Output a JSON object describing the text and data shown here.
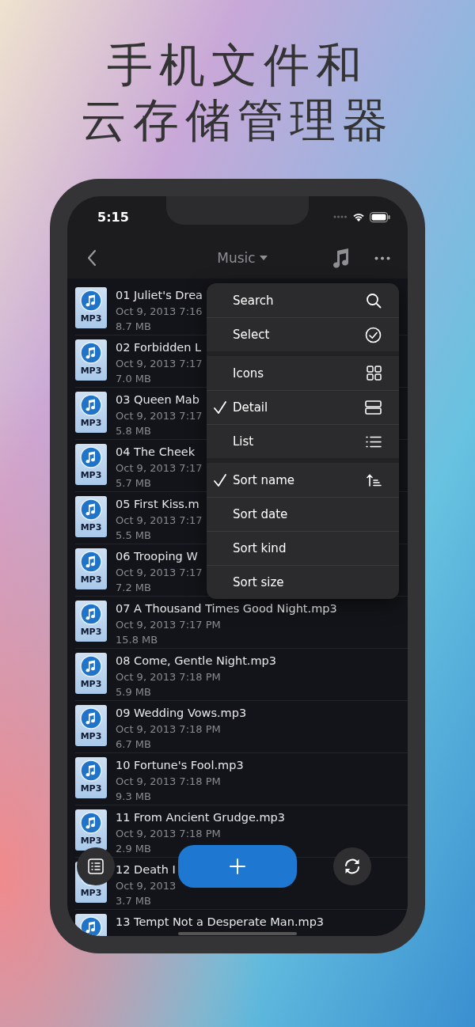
{
  "headline": [
    "手机文件和",
    "云存储管理器"
  ],
  "status_bar": {
    "time": "5:15"
  },
  "nav": {
    "title": "Music"
  },
  "files": [
    {
      "name": "01 Juliet's Drea",
      "date": "Oct 9, 2013 7:16",
      "size": "8.7 MB",
      "badge": "MP3"
    },
    {
      "name": "02 Forbidden L",
      "date": "Oct 9, 2013 7:17",
      "size": "7.0 MB",
      "badge": "MP3"
    },
    {
      "name": "03 Queen Mab",
      "date": "Oct 9, 2013 7:17",
      "size": "5.8 MB",
      "badge": "MP3"
    },
    {
      "name": "04 The Cheek",
      "date": "Oct 9, 2013 7:17",
      "size": "5.7 MB",
      "badge": "MP3"
    },
    {
      "name": "05 First Kiss.m",
      "date": "Oct 9, 2013 7:17",
      "size": "5.5 MB",
      "badge": "MP3"
    },
    {
      "name": "06 Trooping W",
      "date": "Oct 9, 2013 7:17",
      "size": "7.2 MB",
      "badge": "MP3"
    },
    {
      "name": "07 A Thousand Times Good Night.mp3",
      "date": "Oct 9, 2013 7:17 PM",
      "size": "15.8 MB",
      "badge": "MP3"
    },
    {
      "name": "08 Come, Gentle Night.mp3",
      "date": "Oct 9, 2013 7:18 PM",
      "size": "5.9 MB",
      "badge": "MP3"
    },
    {
      "name": "09 Wedding Vows.mp3",
      "date": "Oct 9, 2013 7:18 PM",
      "size": "6.7 MB",
      "badge": "MP3"
    },
    {
      "name": "10 Fortune's Fool.mp3",
      "date": "Oct 9, 2013 7:18 PM",
      "size": "9.3 MB",
      "badge": "MP3"
    },
    {
      "name": "11 From Ancient Grudge.mp3",
      "date": "Oct 9, 2013 7:18 PM",
      "size": "2.9 MB",
      "badge": "MP3"
    },
    {
      "name": "12 Death I",
      "date": "Oct 9, 2013",
      "size": "3.7 MB",
      "badge": "MP3"
    },
    {
      "name": "13 Tempt Not a Desperate Man.mp3"
    }
  ],
  "menu": [
    [
      {
        "label": "Search",
        "checked": false,
        "kind": "search"
      },
      {
        "label": "Select",
        "checked": false,
        "kind": "select"
      }
    ],
    [
      {
        "label": "Icons",
        "checked": false,
        "kind": "grid"
      },
      {
        "label": "Detail",
        "checked": true,
        "kind": "detail"
      },
      {
        "label": "List",
        "checked": false,
        "kind": "list"
      }
    ],
    [
      {
        "label": "Sort name",
        "checked": true,
        "kind": "sort"
      },
      {
        "label": "Sort date",
        "checked": false,
        "kind": "none"
      },
      {
        "label": "Sort kind",
        "checked": false,
        "kind": "none"
      },
      {
        "label": "Sort size",
        "checked": false,
        "kind": "none"
      }
    ]
  ]
}
